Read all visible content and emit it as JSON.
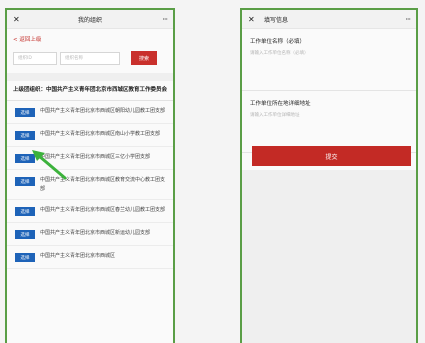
{
  "left": {
    "title": "我的组织",
    "close_glyph": "✕",
    "more_glyph": "···",
    "back_link": "< 返回上级",
    "search": {
      "placeholder_1": "组织ID",
      "placeholder_2": "组织名称",
      "button": "搜索"
    },
    "upper_org": "上级团组织：中国共产主义青年团北京市西城区教育工作委员会",
    "select_label": "选择",
    "items": [
      "中国共产主义青年团北京市西城区朝阳幼儿园教工团支部",
      "中国共产主义青年团北京市西城区南山小学教工团支部",
      "中国共产主义青年团北京市西城区三亿小学团支部",
      "中国共产主义青年团北京市西城区教育交流中心教工团支部",
      "中国共产主义青年团北京市西城区春兰幼儿园教工团支部",
      "中国共产主义青年团北京市西城区新运幼儿园支部",
      "中国共产主义青年团北京市西城区"
    ]
  },
  "right": {
    "title": "填写信息",
    "close_glyph": "✕",
    "more_glyph": "···",
    "field1_label": "工作单位名称（必填）",
    "field1_placeholder": "请输入工作单位名称（必填）",
    "field2_label": "工作单位所在地详细地址",
    "field2_placeholder": "请输入工作单位详细地址",
    "submit": "提交"
  },
  "colors": {
    "accent_red": "#c9302c",
    "select_blue": "#1e63b8",
    "arrow_green": "#3cb23c",
    "frame_green": "#5a9e46"
  }
}
